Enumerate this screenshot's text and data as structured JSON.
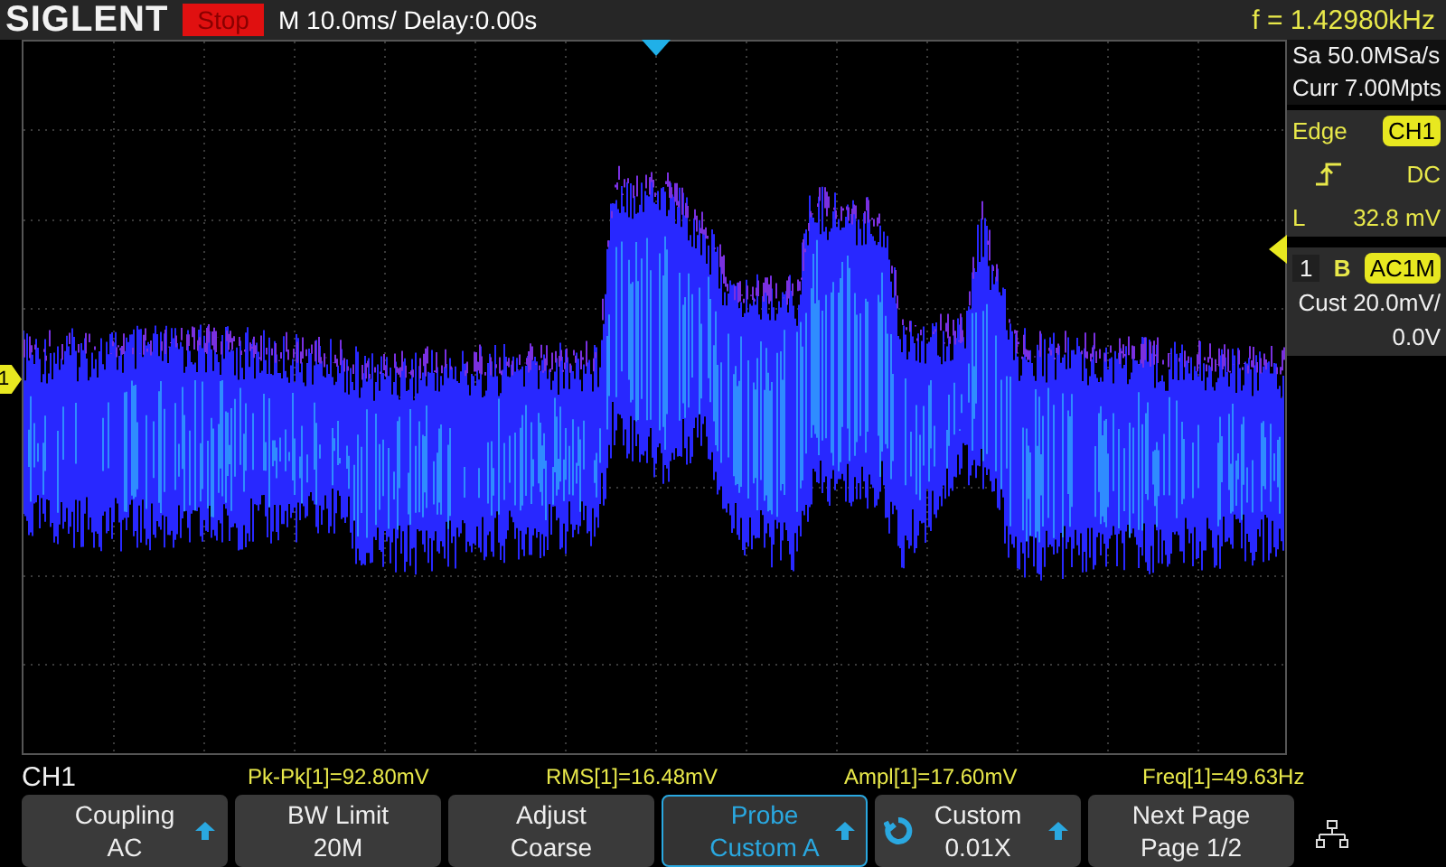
{
  "header": {
    "brand": "SIGLENT",
    "run_state": "Stop",
    "running": false,
    "timebase": "M 10.0ms/ Delay:0.00s",
    "frequency": "f = 1.42980kHz"
  },
  "acquisition": {
    "sample_rate": "Sa 50.0MSa/s",
    "memory": "Curr 7.00Mpts"
  },
  "trigger": {
    "type": "Edge",
    "source": "CH1",
    "coupling": "DC",
    "level_label": "L",
    "level_value": "32.8 mV"
  },
  "channel": {
    "number": "1",
    "bandwidth": "B",
    "coupling": "AC1M",
    "scale": "Cust 20.0mV/",
    "offset": "0.0V"
  },
  "channel_marker": "1",
  "status": {
    "channel": "CH1"
  },
  "measurements": [
    {
      "text": "Pk-Pk[1]=92.80mV"
    },
    {
      "text": "RMS[1]=16.48mV"
    },
    {
      "text": "Ampl[1]=17.60mV"
    },
    {
      "text": "Freq[1]=49.63Hz"
    }
  ],
  "softkeys": [
    {
      "top": "Coupling",
      "bottom": "AC",
      "selected": false,
      "has_arrow": true,
      "has_knob": false
    },
    {
      "top": "BW Limit",
      "bottom": "20M",
      "selected": false,
      "has_arrow": false,
      "has_knob": false
    },
    {
      "top": "Adjust",
      "bottom": "Coarse",
      "selected": false,
      "has_arrow": false,
      "has_knob": false
    },
    {
      "top": "Probe",
      "bottom": "Custom A",
      "selected": true,
      "has_arrow": true,
      "has_knob": false
    },
    {
      "top": "Custom",
      "bottom": "0.01X",
      "selected": false,
      "has_arrow": true,
      "has_knob": true
    },
    {
      "top": "Next Page",
      "bottom": "Page 1/2",
      "selected": false,
      "has_arrow": false,
      "has_knob": false
    }
  ]
}
